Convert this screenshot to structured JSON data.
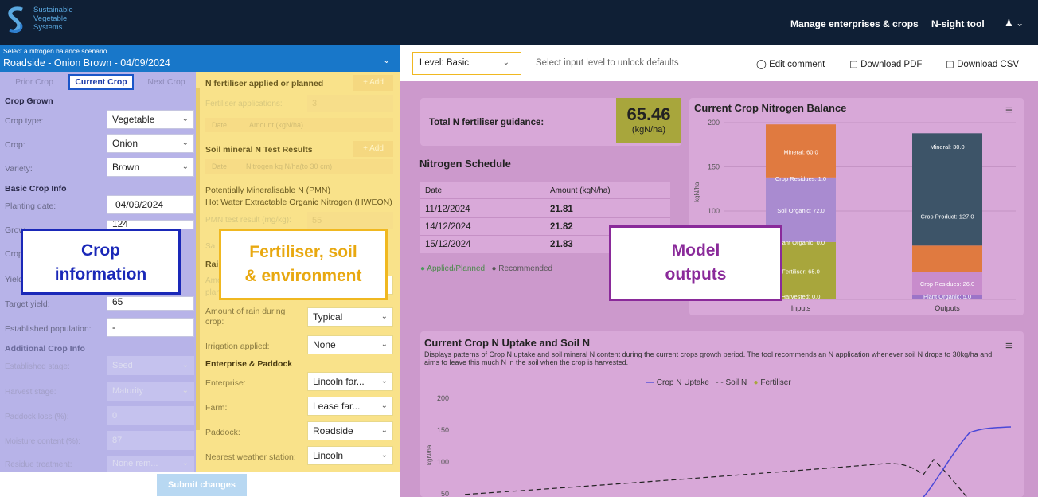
{
  "header": {
    "logo_lines": [
      "Sustainable",
      "Vegetable",
      "Systems"
    ],
    "nav": [
      "Manage enterprises & crops",
      "N-sight tool"
    ],
    "user_icon": "user-icon"
  },
  "scenario": {
    "caption": "Select a nitrogen balance scenario",
    "value": "Roadside - Onion Brown - 04/09/2024"
  },
  "tabs": [
    "Prior Crop",
    "Current Crop",
    "Next Crop"
  ],
  "crop": {
    "grown_title": "Crop Grown",
    "rows": [
      {
        "label": "Crop type:",
        "value": "Vegetable"
      },
      {
        "label": "Crop:",
        "value": "Onion"
      },
      {
        "label": "Variety:",
        "value": "Brown"
      }
    ],
    "basic_title": "Basic Crop Info",
    "planting_label": "Planting date:",
    "planting_value": "04/09/2024",
    "grow_label": "Grow",
    "grow_value": "124",
    "crop_label": "Crop",
    "yield_label": "Yield",
    "target_label": "Target yield:",
    "target_value": "65",
    "estpop_label": "Established population:",
    "estpop_value": "-",
    "add_title": "Additional Crop Info",
    "add_rows": [
      {
        "label": "Established stage:",
        "value": "Seed"
      },
      {
        "label": "Harvest stage:",
        "value": "Maturity"
      },
      {
        "label": "Paddock loss (%):",
        "value": "0"
      },
      {
        "label": "Moisture content (%):",
        "value": "87"
      },
      {
        "label": "Residue treatment:",
        "value": "None rem..."
      }
    ]
  },
  "fert": {
    "applied_title": "N fertiliser applied or planned",
    "add": "+ Add",
    "apps_label": "Fertiliser applications:",
    "apps_value": "3",
    "th_date": "Date",
    "th_amount": "Amount (kgN/ha)",
    "soil_title": "Soil mineral N Test Results",
    "soil_th": "Nitrogen kg N/ha(to 30 cm)",
    "pmn_title": "Potentially Mineralisable N (PMN)",
    "hweon_title": "Hot Water Extractable Organic Nitrogen (HWEON)",
    "pmn_label": "PMN test result (mg/kg):",
    "pmn_value": "55",
    "sa": "Sa",
    "rai": "Rai",
    "am": "Amo",
    "pla": "plan",
    "rain_label": "Amount of rain during crop:",
    "rain_value": "Typical",
    "irr_label": "Irrigation applied:",
    "irr_value": "None",
    "ent_title": "Enterprise & Paddock",
    "ent_rows": [
      {
        "label": "Enterprise:",
        "value": "Lincoln far..."
      },
      {
        "label": "Farm:",
        "value": "Lease far..."
      },
      {
        "label": "Paddock:",
        "value": "Roadside"
      },
      {
        "label": "Nearest weather station:",
        "value": "Lincoln"
      }
    ]
  },
  "submit": "Submit changes",
  "toolbar": {
    "level": "Level: Basic",
    "hint": "Select input level to unlock defaults",
    "edit": "Edit comment",
    "pdf": "Download PDF",
    "csv": "Download CSV"
  },
  "guidance": {
    "label": "Total N fertiliser guidance:",
    "value": "65.46",
    "unit": "(kgN/ha)"
  },
  "schedule": {
    "title": "Nitrogen Schedule",
    "headers": [
      "Date",
      "Amount (kgN/ha)"
    ],
    "rows": [
      [
        "11/12/2024",
        "21.81"
      ],
      [
        "14/12/2024",
        "21.82"
      ],
      [
        "15/12/2024",
        "21.83"
      ]
    ],
    "legend": [
      "Applied/Planned",
      "Recommended"
    ]
  },
  "annotations": {
    "crop": [
      "Crop",
      "information"
    ],
    "fert": [
      "Fertiliser, soil",
      "& environment"
    ],
    "model": [
      "Model",
      "outputs"
    ]
  },
  "chart_data": [
    {
      "type": "bar",
      "title": "Current Crop Nitrogen Balance",
      "ylabel": "kgN/ha",
      "ylim": [
        0,
        200
      ],
      "categories": [
        "Inputs",
        "Outputs"
      ],
      "series": [
        {
          "name": "Fertiliser",
          "values": [
            65,
            0
          ],
          "color": "#a8a63c"
        },
        {
          "name": "Plant Organic",
          "values": [
            0,
            5
          ],
          "color": "#9c74c8"
        },
        {
          "name": "Soil Organic",
          "values": [
            72,
            0
          ],
          "color": "#a98bd0"
        },
        {
          "name": "Crop Residues",
          "values": [
            1,
            26
          ],
          "color": "#c88ccc"
        },
        {
          "name": "Mineral",
          "values": [
            60,
            30
          ],
          "color": "#e07a40"
        },
        {
          "name": "Crop Product",
          "values": [
            0,
            127
          ],
          "color": "#3d5468"
        }
      ],
      "labels_in": [
        "Fertiliser: 65.0",
        "Plant Organic: 0.0",
        "Soil Organic: 72.0",
        "Crop Residues: 1.0",
        "Mineral: 60.0",
        "Harvested: 0.0"
      ],
      "labels_out": [
        "Plant Organic: 5.0",
        "Crop Residues: 26.0",
        "Crop Product: 127.0",
        "Mineral: 30.0"
      ],
      "yticks": [
        100,
        150,
        200
      ]
    },
    {
      "type": "line",
      "title": "Current Crop N Uptake and Soil N",
      "subtitle": "Displays patterns of Crop N uptake and soil mineral N content during the current crops growth period. The tool recommends an N application whenever soil N drops to 30kg/ha and aims to leave this much N in the soil when the crop is harvested.",
      "ylabel": "kgN/ha",
      "yticks": [
        50,
        100,
        150,
        200
      ],
      "legend": [
        "Crop N Uptake",
        "Soil N",
        "Fertiliser"
      ]
    }
  ]
}
